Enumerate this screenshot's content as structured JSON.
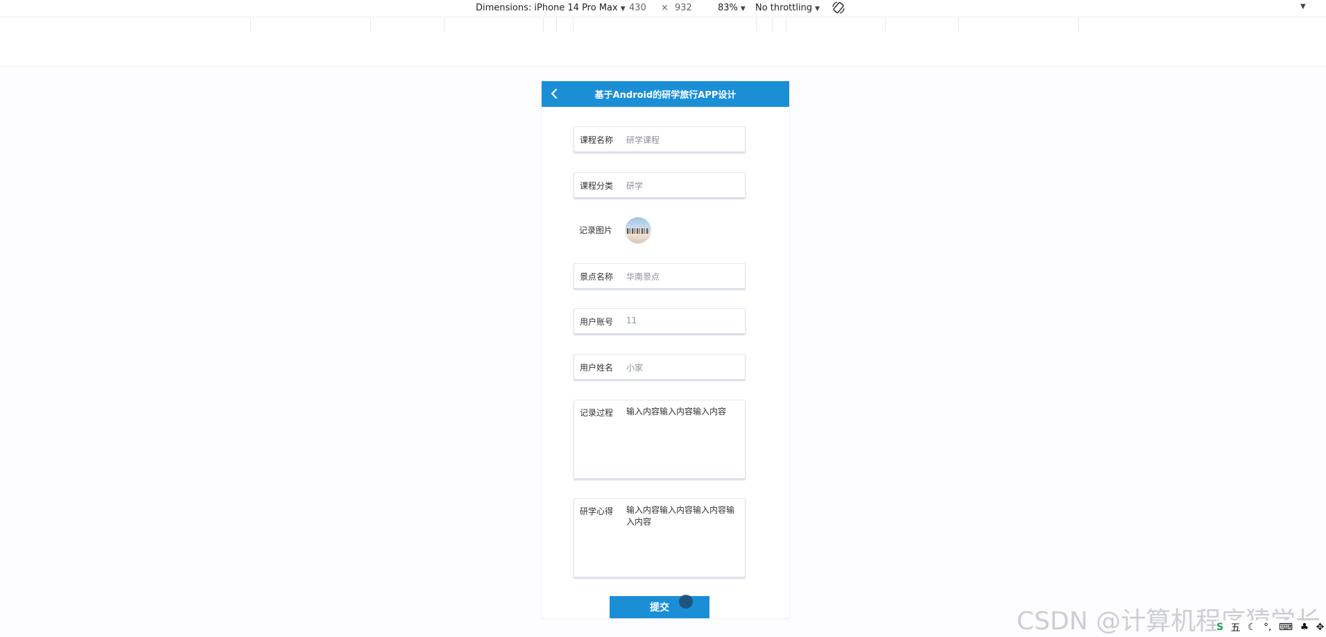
{
  "devtools": {
    "dimensions_label": "Dimensions: iPhone 14 Pro Max",
    "width": "430",
    "times": "×",
    "height": "932",
    "zoom": "83%",
    "throttling": "No throttling"
  },
  "app": {
    "title": "基于Android的研学旅行APP设计"
  },
  "form": {
    "course_name": {
      "label": "课程名称",
      "value": "研学课程"
    },
    "course_category": {
      "label": "课程分类",
      "value": "研学"
    },
    "record_image": {
      "label": "记录图片"
    },
    "spot_name": {
      "label": "景点名称",
      "value": "华南景点"
    },
    "user_account": {
      "label": "用户账号",
      "value": "11"
    },
    "user_name": {
      "label": "用户姓名",
      "value": "小家"
    },
    "record_process": {
      "label": "记录过程",
      "value": "输入内容输入内容输入内容"
    },
    "study_notes": {
      "label": "研学心得",
      "value": "输入内容输入内容输入内容输入内容"
    },
    "submit_label": "提交"
  },
  "watermark": "CSDN @计算机程序猿学长",
  "tray": {
    "ime": "五"
  }
}
